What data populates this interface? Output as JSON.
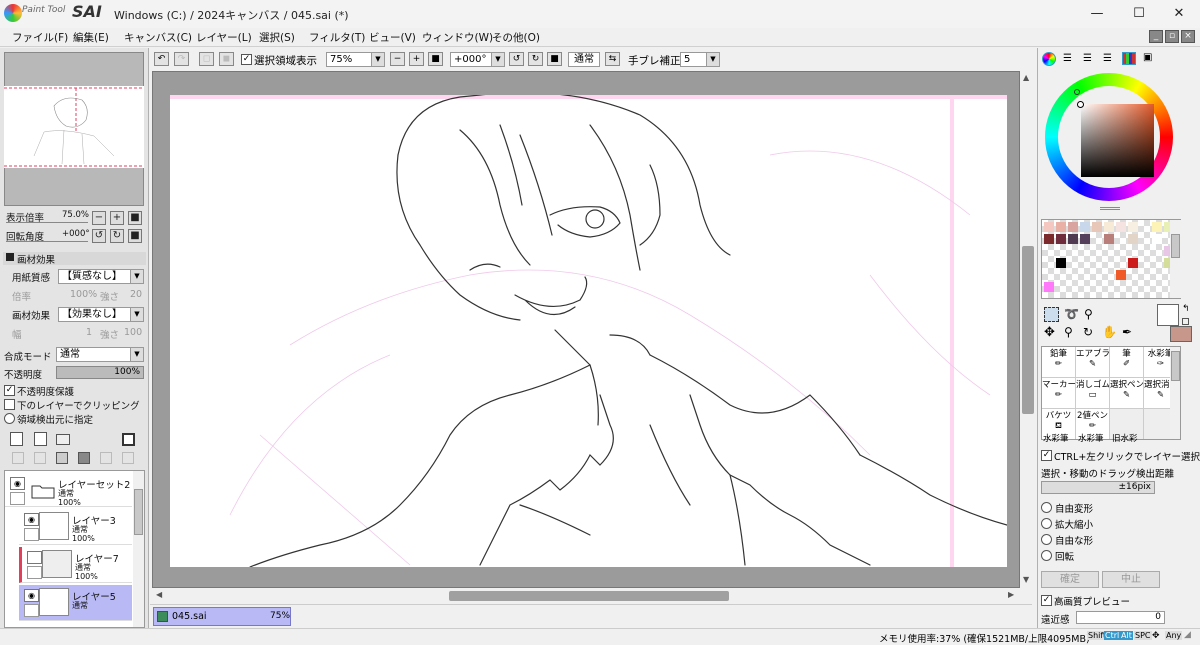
{
  "app": {
    "logo_small": "Paint Tool",
    "logo_big": "SAI",
    "title": "Windows (C:) / 2024キャンバス / 045.sai (*)"
  },
  "window_controls": {
    "minimize": "—",
    "maximize": "☐",
    "close": "✕"
  },
  "menu": [
    "ファイル(F)",
    "編集(E)",
    "キャンバス(C)",
    "レイヤー(L)",
    "選択(S)",
    "フィルタ(T)",
    "ビュー(V)",
    "ウィンドウ(W)",
    "その他(O)"
  ],
  "navigator": {
    "zoom_label": "表示倍率",
    "zoom_value": "75.0%",
    "rotate_label": "回転角度",
    "rotate_value": "+000°"
  },
  "paper_effects": {
    "header": "画材効果",
    "paper_texture_label": "用紙質感",
    "paper_texture_value": "【質感なし】",
    "rate_label": "倍率",
    "rate_value": "100%",
    "strength_label": "強さ",
    "strength_value": "20",
    "material_label": "画材効果",
    "material_value": "【効果なし】",
    "width_label": "幅",
    "width_value": "1",
    "strength2_label": "強さ",
    "strength2_value": "100"
  },
  "layer_props": {
    "blend_label": "合成モード",
    "blend_value": "通常",
    "opacity_label": "不透明度",
    "opacity_value": "100%",
    "protect_opacity": "不透明度保護",
    "clip_below": "下のレイヤーでクリッピング",
    "selection_source": "領域検出元に指定"
  },
  "layers": [
    {
      "name": "レイヤーセット2",
      "mode": "通常",
      "opacity": "100%",
      "visible": true,
      "folder": true
    },
    {
      "name": "レイヤー3",
      "mode": "通常",
      "opacity": "100%",
      "visible": true
    },
    {
      "name": "レイヤー7",
      "mode": "通常",
      "opacity": "100%",
      "visible": false
    },
    {
      "name": "レイヤー5",
      "mode": "通常",
      "opacity": "100%",
      "visible": true,
      "selected": true
    }
  ],
  "toolbar": {
    "show_selection": "選択領域表示",
    "zoom": "75%",
    "angle": "+000°",
    "mode": "通常",
    "stabilizer_label": "手ブレ補正",
    "stabilizer_value": "5"
  },
  "file_tab": {
    "name": "045.sai",
    "zoom": "75%"
  },
  "status": {
    "memory": "メモリ使用率:37% (確保1521MB/上限4095MB)",
    "keys": [
      "Shift",
      "Ctrl",
      "Alt",
      "SPC",
      "Any"
    ]
  },
  "tools": {
    "brushes": [
      "鉛筆",
      "エアブラシ",
      "筆",
      "水彩筆",
      "マーカー",
      "消しゴム",
      "選択ペン",
      "選択消し",
      "バケツ",
      "2値ペン",
      "",
      "",
      "水彩筆",
      "水彩筆",
      "旧水彩",
      ""
    ],
    "ctrl_click_layer": "CTRL+左クリックでレイヤー選択",
    "drag_distance_label": "選択・移動のドラッグ検出距離",
    "drag_distance_value": "±16pix",
    "transform_options": [
      "自由変形",
      "拡大縮小",
      "自由な形",
      "回転"
    ],
    "confirm": "確定",
    "cancel": "中止",
    "hq_preview": "高画質プレビュー",
    "perspective_label": "遠近感",
    "perspective_value": "0"
  },
  "colors": {
    "accent": "#b9b9f5",
    "primary_color": "#ffffff",
    "secondary_color": "#c8978c",
    "swatches": [
      "#f4c7c1",
      "#e9b1a6",
      "#d9a3a0",
      "#c8d7e9",
      "#e8c7b9",
      "#f7ead6",
      "#f4e3e0",
      "#f6efe2",
      "#fdf3b7",
      "#e9f0b6",
      "#7d2a2c",
      "#6e2c3c",
      "#4f3a52",
      "#54405a",
      "#b97f7a",
      "#e2d5c7",
      "#ffffff",
      "#e8c6e6",
      "#000000",
      "#d5dd9b",
      "#cc1a1a",
      "#f05a28",
      "#ff79fa"
    ]
  }
}
